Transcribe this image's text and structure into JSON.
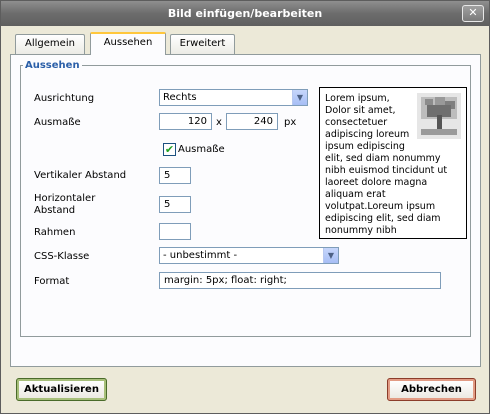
{
  "window": {
    "title": "Bild einfügen/bearbeiten",
    "close_label": "✕"
  },
  "tabs": [
    {
      "label": "Allgemein",
      "active": false
    },
    {
      "label": "Aussehen",
      "active": true
    },
    {
      "label": "Erweitert",
      "active": false
    }
  ],
  "appearance": {
    "legend": "Aussehen",
    "alignment": {
      "label": "Ausrichtung",
      "value": "Rechts"
    },
    "dimensions": {
      "label": "Ausmaße",
      "width": "120",
      "separator": "x",
      "height": "240",
      "unit": "px"
    },
    "constrain": {
      "label": "Ausmaße",
      "checked": true,
      "check_mark": "✔"
    },
    "vspace": {
      "label": "Vertikaler Abstand",
      "value": "5"
    },
    "hspace": {
      "label_line1": "Horizontaler",
      "label_line2": "Abstand",
      "value": "5"
    },
    "border": {
      "label": "Rahmen",
      "value": ""
    },
    "css_class": {
      "label": "CSS-Klasse",
      "value": "- unbestimmt -"
    },
    "style": {
      "label": "Format",
      "value": "margin: 5px; float: right;"
    },
    "preview_text": "Lorem ipsum, Dolor sit amet, consectetuer adipiscing loreum ipsum edipiscing elit, sed diam nonummy nibh euismod tincidunt ut laoreet dolore magna aliquam erat volutpat.Loreum ipsum edipiscing elit, sed diam nonummy nibh"
  },
  "buttons": {
    "update": "Aktualisieren",
    "cancel": "Abbrechen"
  },
  "icons": {
    "dropdown": "▼"
  },
  "colors": {
    "legend": "#2b5fa8",
    "active_tab_accent": "#ffc73c",
    "update_border": "#a7bf7a",
    "cancel_border": "#e29b84"
  }
}
